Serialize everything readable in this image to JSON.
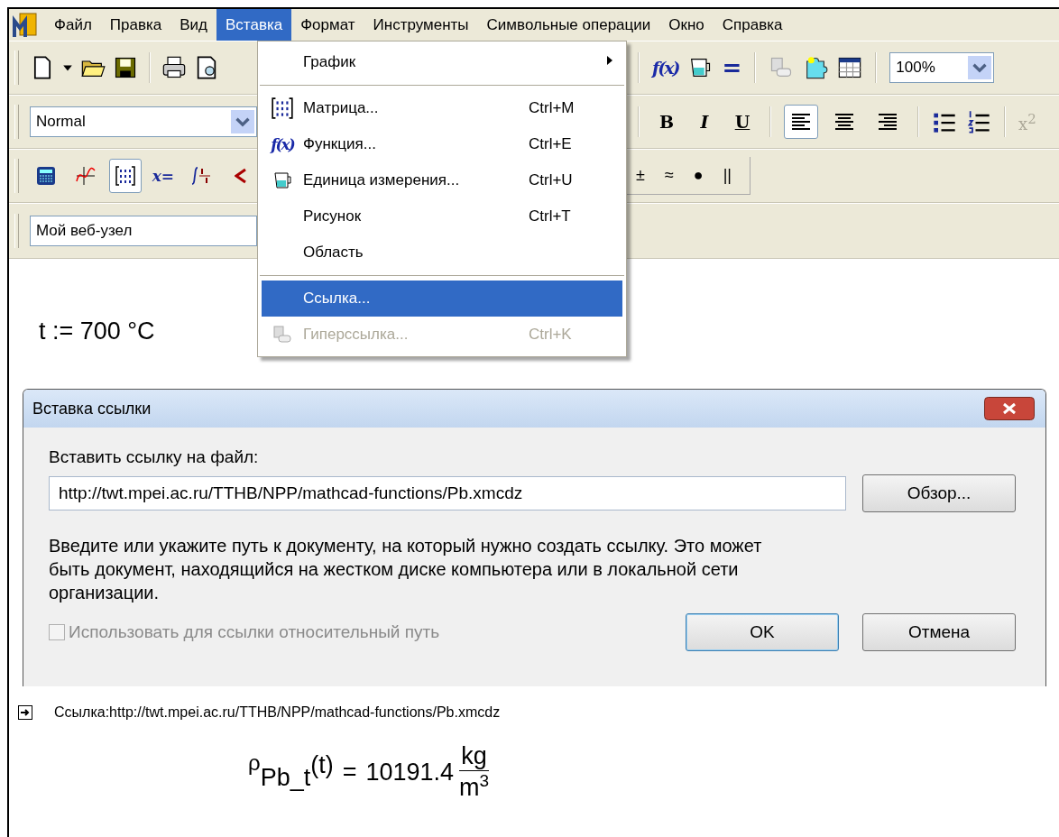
{
  "menu_bar": {
    "items": [
      {
        "label": "Файл",
        "selected": false
      },
      {
        "label": "Правка",
        "selected": false
      },
      {
        "label": "Вид",
        "selected": false
      },
      {
        "label": "Вставка",
        "selected": true
      },
      {
        "label": "Формат",
        "selected": false
      },
      {
        "label": "Инструменты",
        "selected": false
      },
      {
        "label": "Символьные операции",
        "selected": false
      },
      {
        "label": "Окно",
        "selected": false
      },
      {
        "label": "Справка",
        "selected": false
      }
    ]
  },
  "standard_toolbar": {
    "function_glyph": "f(x)",
    "equals_glyph": "=",
    "zoom": "100%"
  },
  "formatting_toolbar": {
    "style": "Normal",
    "text_styles": [
      {
        "kind": "bold",
        "label": "B"
      },
      {
        "kind": "italic",
        "label": "I"
      },
      {
        "kind": "underline",
        "label": "U"
      }
    ],
    "alignment": [
      {
        "kind": "left",
        "selected": true
      },
      {
        "kind": "center",
        "selected": false
      },
      {
        "kind": "right",
        "selected": false
      }
    ],
    "superscript": {
      "label": "x",
      "power": "2",
      "disabled": true
    }
  },
  "math_toolbar": {
    "palettes": [
      {
        "kind": "calculator",
        "selected": false
      },
      {
        "kind": "graph",
        "selected": false
      },
      {
        "kind": "matrix",
        "selected": true
      },
      {
        "kind": "evaluation",
        "label": "x=",
        "selected": false
      },
      {
        "kind": "calculus",
        "selected": false
      },
      {
        "kind": "boolean",
        "selected": false
      }
    ]
  },
  "symbols_toolbar": {
    "symbols": [
      "±",
      "≈",
      "●",
      "||"
    ]
  },
  "resources_toolbar": {
    "value": "Мой веб-узел"
  },
  "insert_menu": {
    "items": [
      {
        "kind": "item",
        "label": "График",
        "submenu": true,
        "selected": false,
        "disabled": false
      },
      {
        "kind": "separator"
      },
      {
        "kind": "item",
        "label": "Матрица...",
        "shortcut": "Ctrl+M",
        "selected": false,
        "disabled": false
      },
      {
        "kind": "item",
        "label": "Функция...",
        "glyph": "f(x)",
        "shortcut": "Ctrl+E",
        "selected": false,
        "disabled": false
      },
      {
        "kind": "item",
        "label": "Единица измерения...",
        "shortcut": "Ctrl+U",
        "selected": false,
        "disabled": false
      },
      {
        "kind": "item",
        "label": "Рисунок",
        "shortcut": "Ctrl+T",
        "selected": false,
        "disabled": false
      },
      {
        "kind": "item",
        "label": "Область",
        "selected": false,
        "disabled": false
      },
      {
        "kind": "separator"
      },
      {
        "kind": "item",
        "label": "Ссылка...",
        "selected": true,
        "disabled": false
      },
      {
        "kind": "item",
        "label": "Гиперссылка...",
        "shortcut": "Ctrl+K",
        "selected": false,
        "disabled": true
      }
    ]
  },
  "worksheet": {
    "assignment": "t := 700 °C",
    "link": "Ссылка:http://twt.mpei.ac.ru/TTHB/NPP/mathcad-functions/Pb.xmcdz",
    "formula": {
      "symbol": "ρ",
      "subscript": "Pb_t",
      "argument": "(t)",
      "equals": "=",
      "value": "10191.4",
      "numerator": "kg",
      "denominator": "m",
      "power": "3"
    }
  },
  "dialog": {
    "title": "Вставка ссылки",
    "field_label": "Вставить ссылку на файл:",
    "path": "http://twt.mpei.ac.ru/TTHB/NPP/mathcad-functions/Pb.xmcdz",
    "browse_button": "Обзор...",
    "description": "Введите или укажите путь к документу, на который нужно создать ссылку. Это может быть документ, находящийся на жестком диске компьютера или в локальной сети организации.",
    "relative_path": {
      "label": "Использовать для ссылки относительный путь",
      "checked": false,
      "disabled": true
    },
    "buttons": [
      {
        "label": "OK",
        "default": true
      },
      {
        "label": "Отмена",
        "default": false
      }
    ]
  }
}
